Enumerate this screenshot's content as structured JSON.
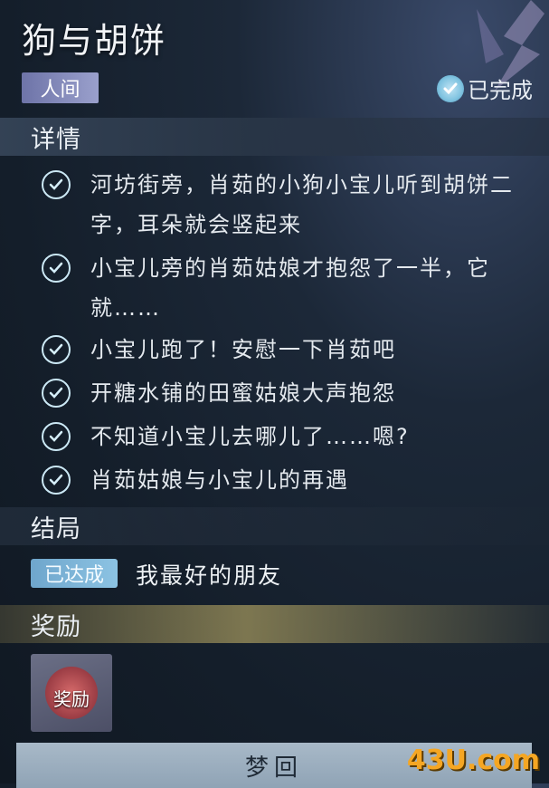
{
  "quest": {
    "title": "狗与胡饼",
    "region": "人间",
    "status": "已完成"
  },
  "sections": {
    "details": "详情",
    "ending": "结局",
    "reward": "奖励"
  },
  "tasks": [
    {
      "text": "河坊街旁，肖茹的小狗小宝儿听到胡饼二字，耳朵就会竖起来"
    },
    {
      "text": "小宝儿旁的肖茹姑娘才抱怨了一半，它就……"
    },
    {
      "text": "小宝儿跑了！安慰一下肖茹吧"
    },
    {
      "text": "开糖水铺的田蜜姑娘大声抱怨"
    },
    {
      "text": "不知道小宝儿去哪儿了……嗯?"
    },
    {
      "text": "肖茹姑娘与小宝儿的再遇"
    }
  ],
  "ending": {
    "badge": "已达成",
    "text": "我最好的朋友"
  },
  "reward": {
    "item_label": "奖励",
    "icon": "question-mark-icon"
  },
  "button": {
    "label": "梦回"
  },
  "watermark": "43U.com",
  "colors": {
    "region_badge": "#8a8fc0",
    "ending_badge": "#7db6db",
    "button": "#9caebf"
  }
}
